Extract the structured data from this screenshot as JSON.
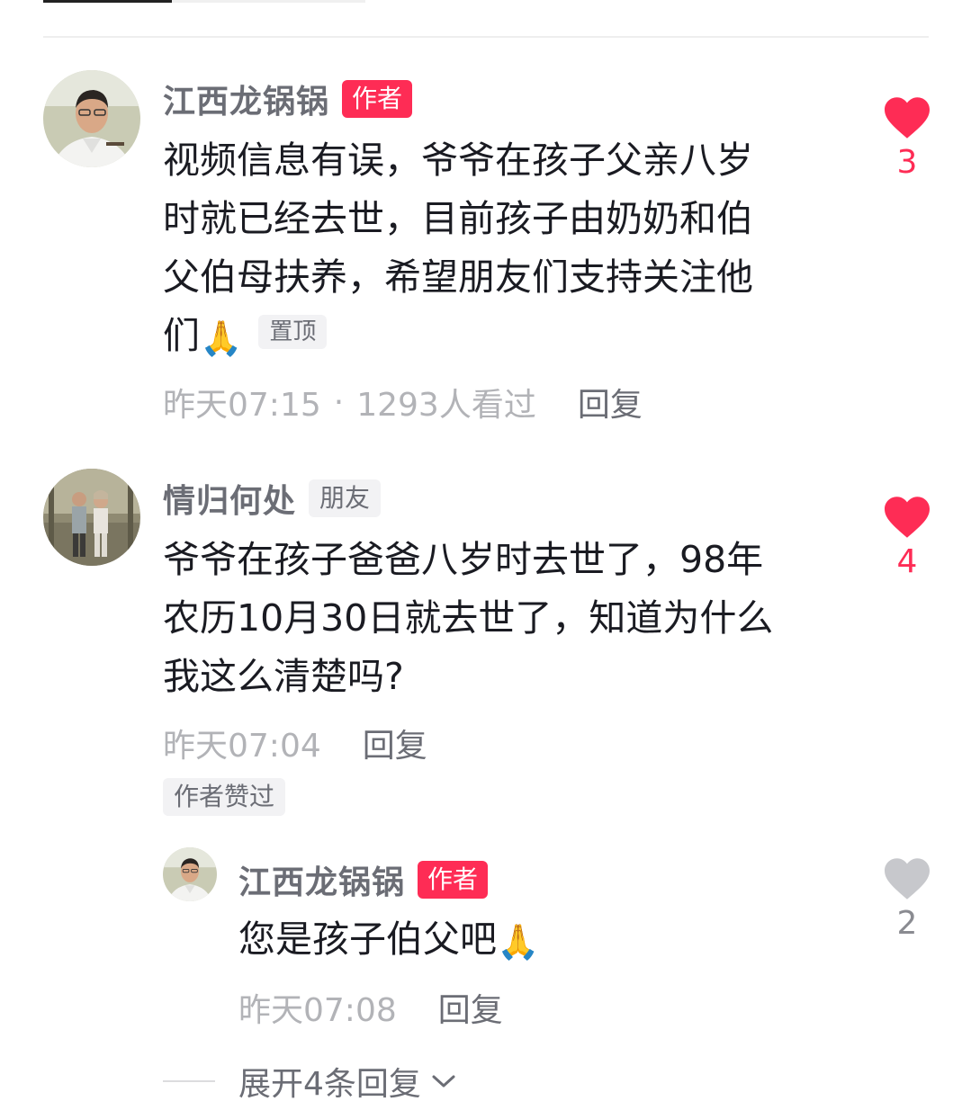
{
  "comments": [
    {
      "name": "江西龙锅锅",
      "tag": "作者",
      "text_lines": [
        "视频信息有误，爷爷在孩子父亲八岁",
        "时就已经去世，目前孩子由奶奶和伯",
        "父伯母扶养，希望朋友们支持关注他",
        "们"
      ],
      "text_emoji": "🙏",
      "pin_label": "置顶",
      "time": "昨天07:15",
      "views": "1293人看过",
      "reply_label": "回复",
      "like_count": "3",
      "liked": true
    },
    {
      "name": "情归何处",
      "tag": "朋友",
      "text_lines": [
        "爷爷在孩子爸爸八岁时去世了，98年",
        "农历10月30日就去世了，知道为什么",
        "我这么清楚吗?"
      ],
      "time": "昨天07:04",
      "reply_label": "回复",
      "liked_by_author": "作者赞过",
      "like_count": "4",
      "liked": true
    }
  ],
  "reply": {
    "name": "江西龙锅锅",
    "tag": "作者",
    "text": "您是孩子伯父吧",
    "text_emoji": "🙏",
    "time": "昨天07:08",
    "reply_label": "回复",
    "like_count": "2",
    "liked": false
  },
  "expand_label": "展开4条回复",
  "colors": {
    "accent": "#fe2c55",
    "muted": "#b2b3b7",
    "secondary": "#6b6d75",
    "heart_off": "#c7c8cc"
  }
}
